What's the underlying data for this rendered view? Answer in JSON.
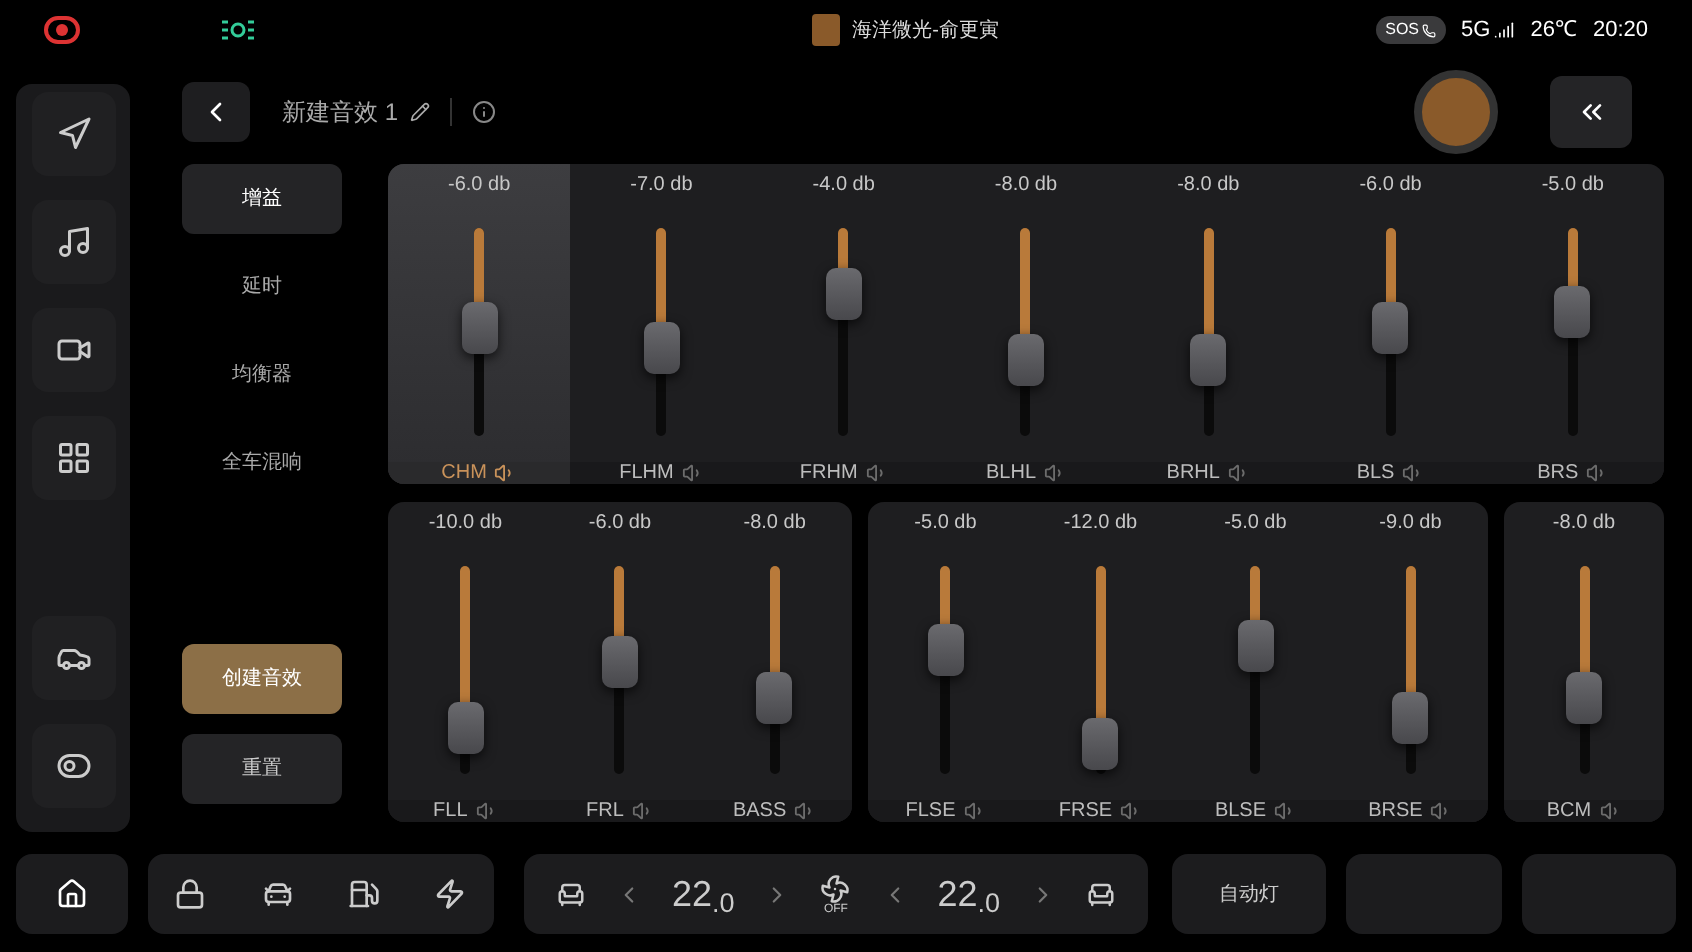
{
  "status_bar": {
    "now_playing": "海洋微光-俞更寅",
    "sos": "SOS",
    "network": "5G",
    "temperature": "26℃",
    "time": "20:20"
  },
  "header": {
    "title": "新建音效 1"
  },
  "menu": [
    {
      "label": "增益",
      "selected": true
    },
    {
      "label": "延时",
      "selected": false
    },
    {
      "label": "均衡器",
      "selected": false
    },
    {
      "label": "全车混响",
      "selected": false
    }
  ],
  "actions": [
    {
      "label": "创建音效",
      "kind": "primary"
    },
    {
      "label": "重置",
      "kind": "secondary"
    }
  ],
  "top_panel": {
    "channels": [
      {
        "name": "CHM",
        "reading": "-6.0 db",
        "level": 0.52,
        "selected": true
      },
      {
        "name": "FLHM",
        "reading": "-7.0 db",
        "level": 0.42,
        "selected": false
      },
      {
        "name": "FRHM",
        "reading": "-4.0 db",
        "level": 0.68,
        "selected": false
      },
      {
        "name": "BLHL",
        "reading": "-8.0 db",
        "level": 0.37,
        "selected": false
      },
      {
        "name": "BRHL",
        "reading": "-8.0 db",
        "level": 0.37,
        "selected": false
      },
      {
        "name": "BLS",
        "reading": "-6.0 db",
        "level": 0.52,
        "selected": false
      },
      {
        "name": "BRS",
        "reading": "-5.0 db",
        "level": 0.6,
        "selected": false
      }
    ]
  },
  "bottom_panels": [
    {
      "channels": [
        {
          "name": "FLL",
          "reading": "-10.0 db",
          "level": 0.22,
          "selected": false
        },
        {
          "name": "FRL",
          "reading": "-6.0 db",
          "level": 0.54,
          "selected": false
        },
        {
          "name": "BASS",
          "reading": "-8.0 db",
          "level": 0.37,
          "selected": false
        }
      ]
    },
    {
      "channels": [
        {
          "name": "FLSE",
          "reading": "-5.0 db",
          "level": 0.6,
          "selected": false
        },
        {
          "name": "FRSE",
          "reading": "-12.0 db",
          "level": 0.14,
          "selected": false
        },
        {
          "name": "BLSE",
          "reading": "-5.0 db",
          "level": 0.62,
          "selected": false
        },
        {
          "name": "BRSE",
          "reading": "-9.0 db",
          "level": 0.27,
          "selected": false
        }
      ]
    },
    {
      "channels": [
        {
          "name": "BCM",
          "reading": "-8.0 db",
          "level": 0.37,
          "selected": false
        }
      ]
    }
  ],
  "dock": {
    "driver_temp": "22$_{.0}$",
    "fan": "OFF",
    "passenger_temp": "22$_{.0}$",
    "auto_light": "自动灯"
  }
}
